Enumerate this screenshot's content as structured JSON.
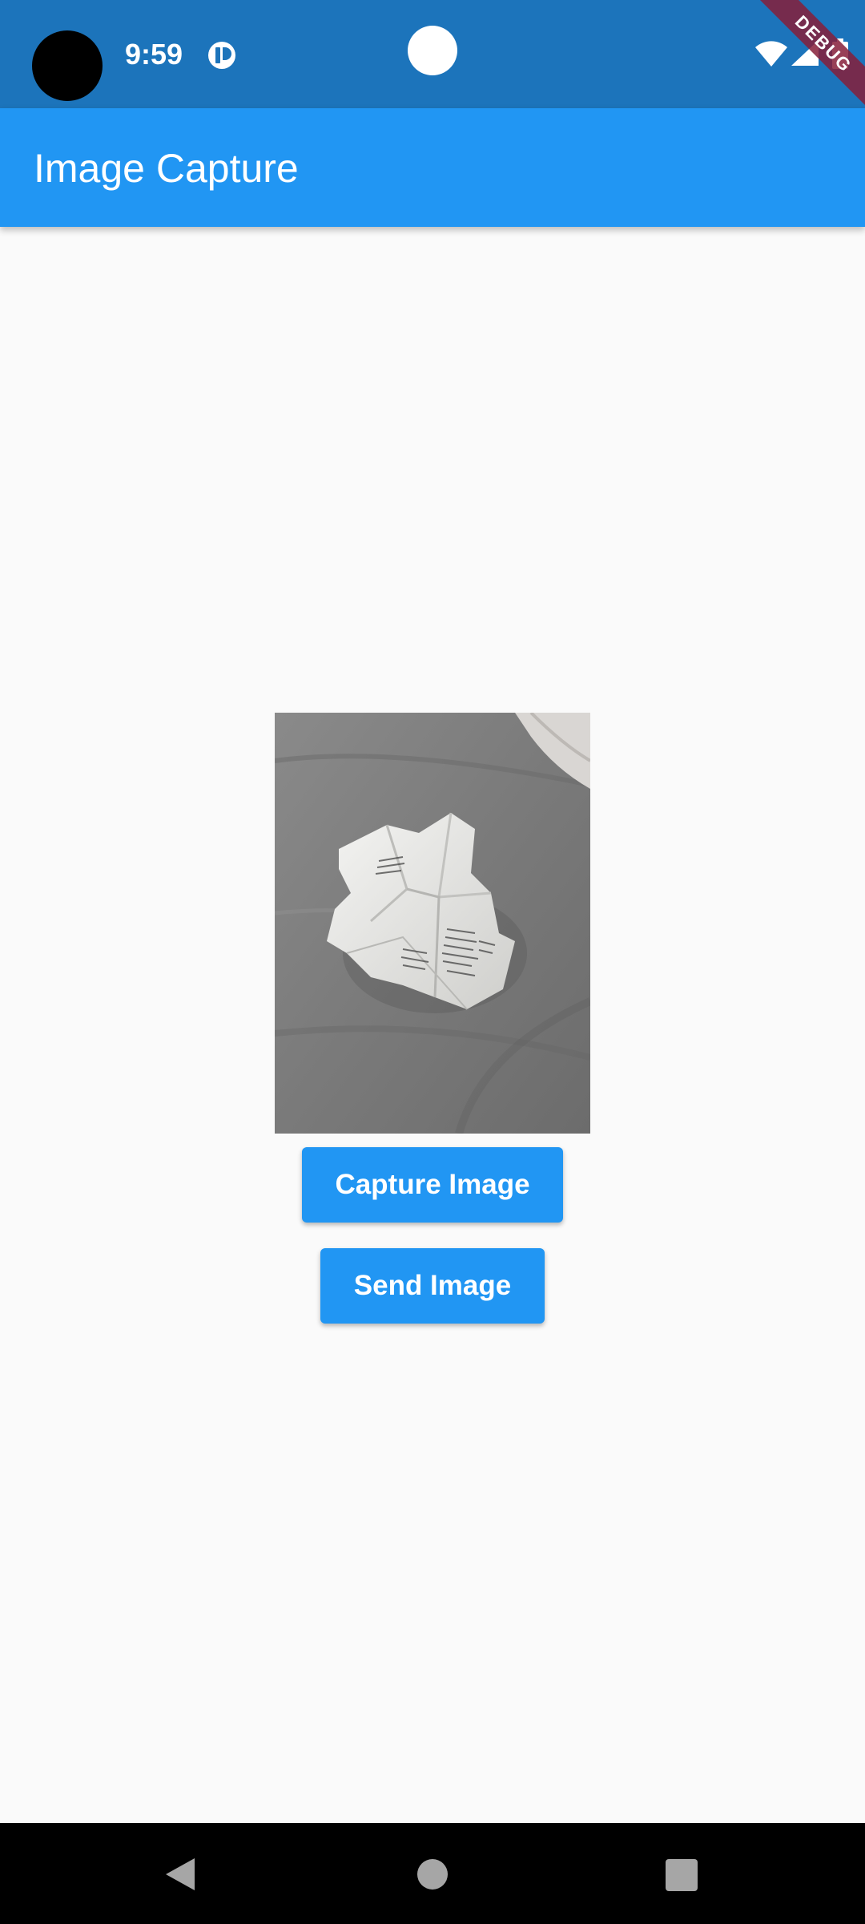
{
  "status_bar": {
    "time": "9:59",
    "color": "#1c74bb",
    "icons": [
      "notification-icon",
      "wifi-icon",
      "signal-icon",
      "battery-icon"
    ]
  },
  "debug_banner": {
    "label": "DEBUG",
    "color": "#861f3a"
  },
  "app_bar": {
    "title": "Image Capture",
    "color": "#2196f3"
  },
  "content": {
    "preview_image_icon": "captured-photo-crumpled-paper",
    "capture_button_label": "Capture Image",
    "send_button_label": "Send Image"
  },
  "nav_bar": {
    "icons": [
      "back-icon",
      "home-icon",
      "recents-icon"
    ]
  }
}
